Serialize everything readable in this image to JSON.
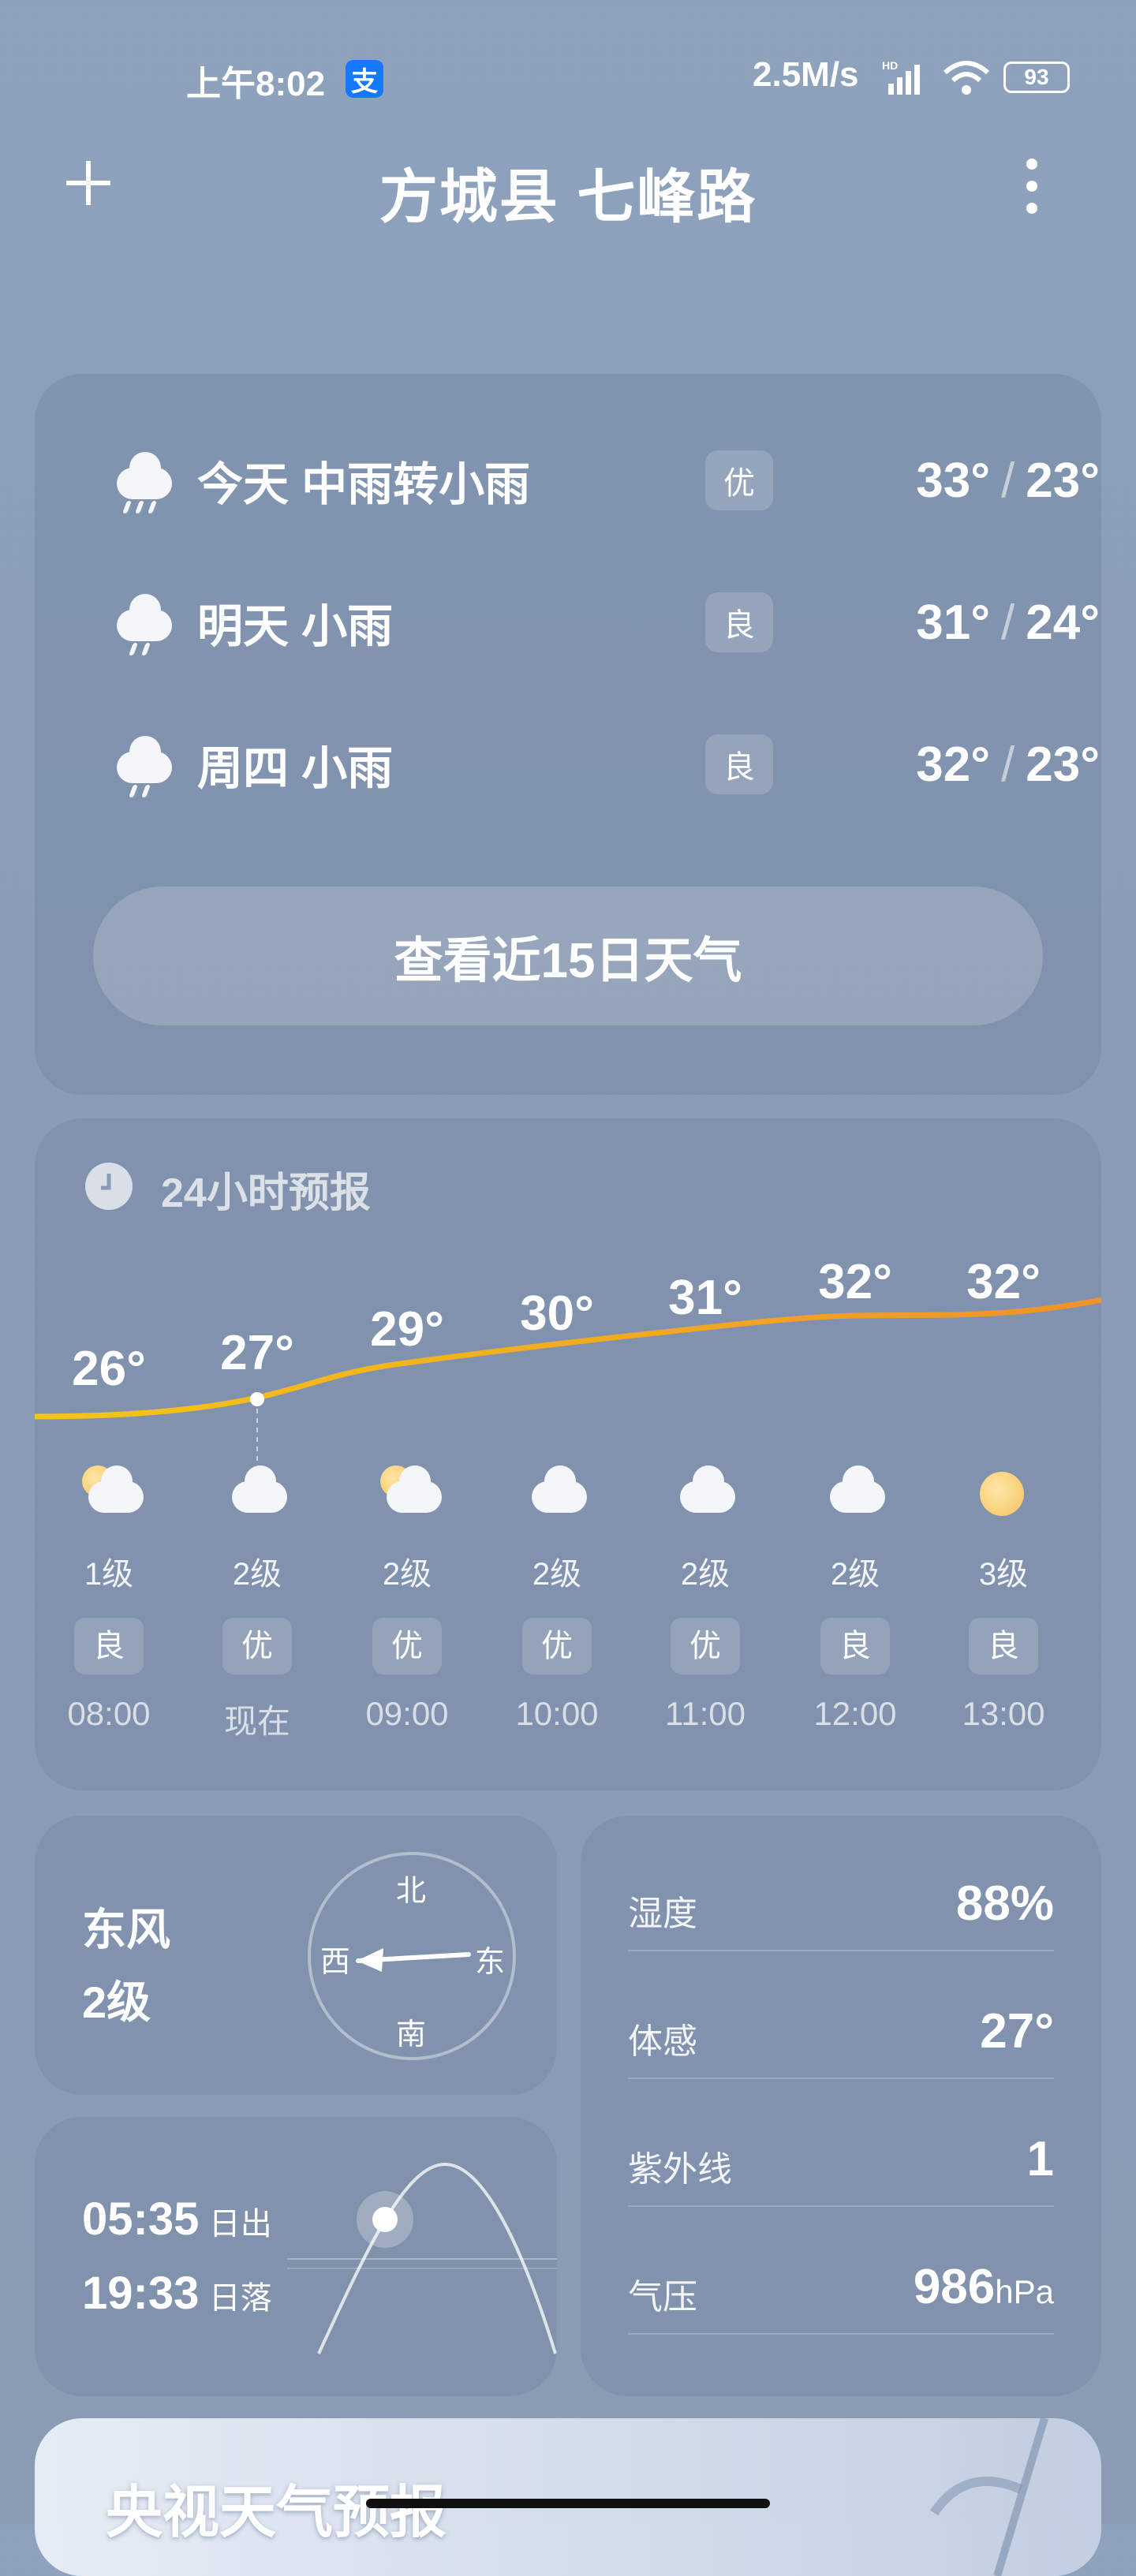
{
  "status_bar": {
    "time": "上午8:02",
    "alipay_icon": "支",
    "net_speed": "2.5M/s",
    "battery": "93",
    "hd": "HD"
  },
  "header": {
    "add_icon": "plus-icon",
    "title": "方城县 七峰路",
    "menu_icon": "more-vertical-icon"
  },
  "daily": {
    "rows": [
      {
        "icon": "heavy-rain",
        "label": "今天  中雨转小雨",
        "aqi": "优",
        "high": "33°",
        "low": "23°"
      },
      {
        "icon": "light-rain",
        "label": "明天  小雨",
        "aqi": "良",
        "high": "31°",
        "low": "24°"
      },
      {
        "icon": "light-rain",
        "label": "周四  小雨",
        "aqi": "良",
        "high": "32°",
        "low": "23°"
      }
    ],
    "button_label": "查看近15日天气"
  },
  "hourly": {
    "title": "24小时预报",
    "hours": [
      {
        "temp": "26°",
        "icon": "partly-cloudy",
        "wind": "1级",
        "aqi": "良",
        "time": "08:00"
      },
      {
        "temp": "27°",
        "icon": "cloudy",
        "wind": "2级",
        "aqi": "优",
        "time": "现在"
      },
      {
        "temp": "29°",
        "icon": "partly-cloudy",
        "wind": "2级",
        "aqi": "优",
        "time": "09:00"
      },
      {
        "temp": "30°",
        "icon": "cloudy",
        "wind": "2级",
        "aqi": "优",
        "time": "10:00"
      },
      {
        "temp": "31°",
        "icon": "cloudy",
        "wind": "2级",
        "aqi": "优",
        "time": "11:00"
      },
      {
        "temp": "32°",
        "icon": "cloudy",
        "wind": "2级",
        "aqi": "良",
        "time": "12:00"
      },
      {
        "temp": "32°",
        "icon": "sunny",
        "wind": "3级",
        "aqi": "良",
        "time": "13:00"
      }
    ]
  },
  "wind": {
    "direction": "东风",
    "level": "2级",
    "compass": {
      "n": "北",
      "s": "南",
      "w": "西",
      "e": "东"
    }
  },
  "sun": {
    "sunrise": "05:35",
    "sunrise_label": "日出",
    "sunset": "19:33",
    "sunset_label": "日落"
  },
  "details": [
    {
      "label": "湿度",
      "value": "88%",
      "unit": ""
    },
    {
      "label": "体感",
      "value": "27°",
      "unit": ""
    },
    {
      "label": "紫外线",
      "value": "1",
      "unit": ""
    },
    {
      "label": "气压",
      "value": "986",
      "unit": "hPa"
    }
  ],
  "bottom_card": {
    "title": "央视天气预报"
  },
  "colors": {
    "temp_line_start": "#f5c518",
    "temp_line_end": "#f0922a"
  }
}
